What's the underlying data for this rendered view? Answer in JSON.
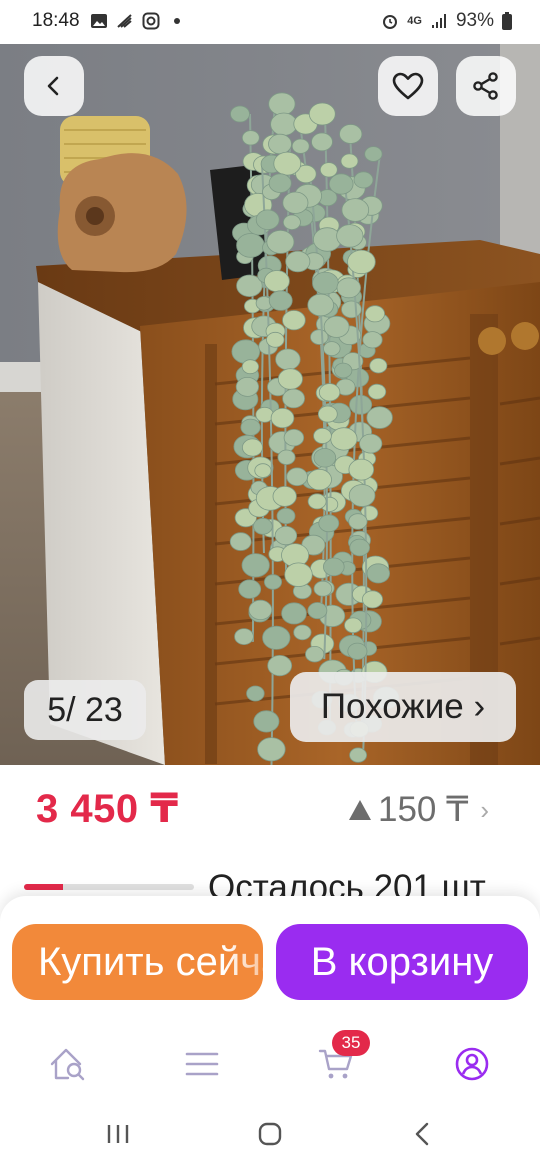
{
  "status_bar": {
    "time": "18:48",
    "battery": "93%",
    "network": "4G"
  },
  "gallery": {
    "counter": "5/ 23",
    "similar_label": "Похожие ›"
  },
  "product": {
    "price": "3 450 ₸",
    "bonus": "150 ₸",
    "stock_text": "Осталось 201 шт",
    "stock_fraction": 0.23
  },
  "actions": {
    "buy_now_label": "Купить сейчас",
    "add_to_cart_label": "В корзину"
  },
  "tabbar": {
    "cart_badge": "35"
  },
  "colors": {
    "accent_red": "#e3294a",
    "buy_orange": "#f2893a",
    "cart_purple": "#9a2cf0",
    "tab_icon_purple": "#9a2cf0"
  },
  "icons": [
    "back-icon",
    "heart-icon",
    "share-icon",
    "home-search-icon",
    "catalog-icon",
    "cart-icon",
    "profile-icon"
  ]
}
